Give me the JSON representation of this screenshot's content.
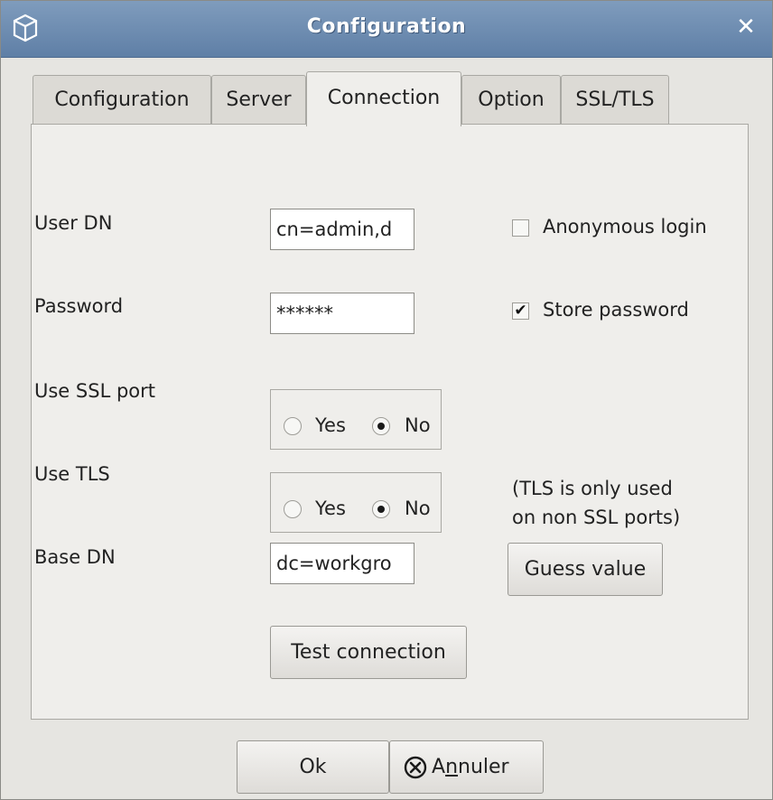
{
  "window": {
    "title": "Configuration"
  },
  "tabs": [
    {
      "label": "Configuration"
    },
    {
      "label": "Server"
    },
    {
      "label": "Connection",
      "active": true
    },
    {
      "label": "Option"
    },
    {
      "label": "SSL/TLS"
    }
  ],
  "connection": {
    "user_dn": {
      "label": "User DN",
      "value": "cn=admin,d"
    },
    "password": {
      "label": "Password",
      "value": "******"
    },
    "use_ssl_port": {
      "label": "Use SSL port",
      "yes": "Yes",
      "no": "No",
      "selected": "No"
    },
    "use_tls": {
      "label": "Use TLS",
      "yes": "Yes",
      "no": "No",
      "selected": "No"
    },
    "base_dn": {
      "label": "Base DN",
      "value": "dc=workgro"
    },
    "anonymous_login": {
      "label": "Anonymous login",
      "checked": false
    },
    "store_password": {
      "label": "Store password",
      "checked": true
    },
    "tls_note_line1": "(TLS is only used",
    "tls_note_line2": "on non SSL ports)",
    "guess_value_button": "Guess value",
    "test_connection_button": "Test connection"
  },
  "footer": {
    "ok_button": "Ok",
    "cancel_button_pre": "A",
    "cancel_button_mnemonic": "n",
    "cancel_button_post": "nuler"
  }
}
